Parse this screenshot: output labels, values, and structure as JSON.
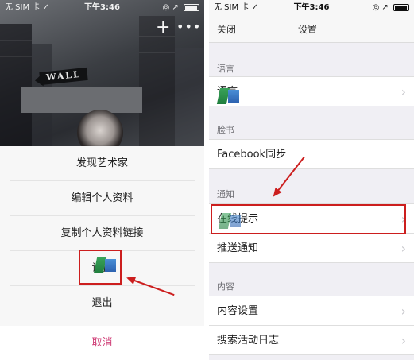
{
  "left": {
    "status": {
      "carrier": "无 SIM 卡 ✓",
      "time": "下午3:46",
      "icons": "◎ ↗"
    },
    "hero": {
      "sign_text": "WALL",
      "plus": "+",
      "more": "•••"
    },
    "menu": {
      "items": [
        "发现艺术家",
        "编辑个人资料",
        "复制个人资料链接",
        "设置",
        "退出"
      ],
      "cancel": "取消"
    }
  },
  "right": {
    "status": {
      "carrier": "无 SIM 卡 ✓",
      "time": "下午3:46",
      "icons": "◎ ↗"
    },
    "nav": {
      "close": "关闭",
      "title": "设置"
    },
    "sections": [
      {
        "header": "语言",
        "rows": [
          "语言"
        ]
      },
      {
        "header": "脸书",
        "rows": [
          "Facebook同步"
        ]
      },
      {
        "header": "通知",
        "rows": [
          "在线提示",
          "推送通知"
        ]
      },
      {
        "header": "内容",
        "rows": [
          "内容设置",
          "搜索活动日志"
        ]
      }
    ],
    "chevron": "›"
  },
  "colors": {
    "highlight": "#cc1e1e",
    "cancel": "#d0437a",
    "background": "#f0eff4"
  }
}
